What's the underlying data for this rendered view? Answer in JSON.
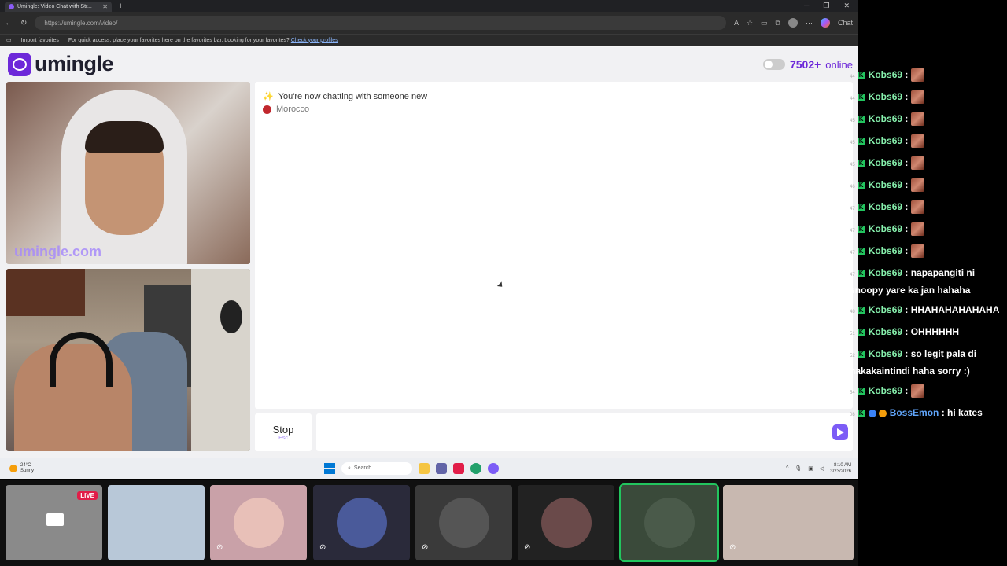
{
  "browser": {
    "tab_title": "Umingle: Video Chat with Str...",
    "url": "https://umingle.com/video/",
    "chat_label": "Chat",
    "favbar_import": "Import favorites",
    "favbar_hint": "For quick access, place your favorites here on the favorites bar. Looking for your favorites?",
    "favbar_link": "Check your profiles"
  },
  "site": {
    "logo_text": "umingle",
    "online_count": "7502+",
    "online_label": "online",
    "watermark": "umingle.com"
  },
  "chat_panel": {
    "system_message": "You're now chatting with someone new",
    "country": "Morocco",
    "stop_label": "Stop",
    "stop_hint": "Esc",
    "message_placeholder": ""
  },
  "taskbar": {
    "temp": "24°C",
    "condition": "Sunny",
    "search_label": "Search",
    "time": "8:10 AM",
    "date": "3/23/2026"
  },
  "strip": {
    "live_label": "LIVE"
  },
  "stream_chat": [
    {
      "ts": "44",
      "user": "Kobs69",
      "text": "",
      "emote": true
    },
    {
      "ts": "44",
      "user": "Kobs69",
      "text": "",
      "emote": true
    },
    {
      "ts": "45",
      "user": "Kobs69",
      "text": "",
      "emote": true
    },
    {
      "ts": "45",
      "user": "Kobs69",
      "text": "",
      "emote": true
    },
    {
      "ts": "45",
      "user": "Kobs69",
      "text": "",
      "emote": true
    },
    {
      "ts": "46",
      "user": "Kobs69",
      "text": "",
      "emote": true
    },
    {
      "ts": "47",
      "user": "Kobs69",
      "text": "",
      "emote": true
    },
    {
      "ts": "47",
      "user": "Kobs69",
      "text": "",
      "emote": true
    },
    {
      "ts": "47",
      "user": "Kobs69",
      "text": "",
      "emote": true
    },
    {
      "ts": "47",
      "user": "Kobs69",
      "text": "napapangiti ni snoopy yare ka jan hahaha",
      "emote": false
    },
    {
      "ts": "48",
      "user": "Kobs69",
      "text": "HHAHAHAHAHAHA",
      "emote": false
    },
    {
      "ts": "51",
      "user": "Kobs69",
      "text": "OHHHHHH",
      "emote": false
    },
    {
      "ts": "52",
      "user": "Kobs69",
      "text": "so legit pala di nakakaintindi haha sorry :)",
      "emote": false
    },
    {
      "ts": "54",
      "user": "Kobs69",
      "text": "",
      "emote": true
    },
    {
      "ts": "08",
      "user": "BossEmon",
      "text": "hi kates",
      "emote": false
    }
  ],
  "colors": {
    "brand": "#6d28d9",
    "send_button": "#7c5cf6",
    "live_badge": "#e11d48",
    "chat_user": "#86efac"
  }
}
